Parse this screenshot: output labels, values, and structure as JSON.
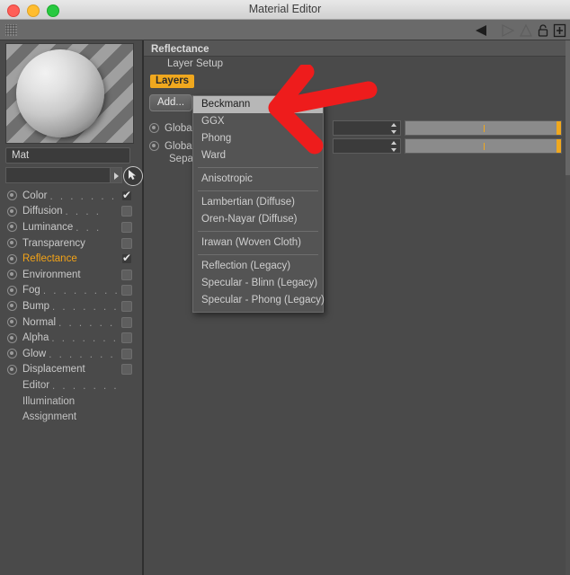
{
  "window": {
    "title": "Material Editor",
    "traffic_lights": [
      "close-red",
      "minimize-yellow",
      "zoom-green"
    ]
  },
  "toolbar": {
    "grip_icon": "dotted-grip-icon",
    "icons": [
      "back-triangle-icon",
      "forward-triangle-icon",
      "up-triangle-icon",
      "lock-icon",
      "plus-box-icon"
    ]
  },
  "left_panel": {
    "preview_alt": "material-preview-sphere",
    "name_value": "Mat",
    "filter_value": "",
    "filter_arrow_icon": "triangle-right-icon",
    "picker_icon": "cursor-picker-icon",
    "channels": [
      {
        "label": "Color",
        "dots": ". . . . . . .",
        "checked": true,
        "active": false
      },
      {
        "label": "Diffusion",
        "dots": ". . . .",
        "checked": false,
        "active": false
      },
      {
        "label": "Luminance",
        "dots": ". . .",
        "checked": false,
        "active": false
      },
      {
        "label": "Transparency",
        "dots": "",
        "checked": false,
        "active": false
      },
      {
        "label": "Reflectance",
        "dots": "",
        "checked": true,
        "active": true
      },
      {
        "label": "Environment",
        "dots": "",
        "checked": false,
        "active": false
      },
      {
        "label": "Fog",
        "dots": ". . . . . . . .",
        "checked": false,
        "active": false
      },
      {
        "label": "Bump",
        "dots": ". . . . . . .",
        "checked": false,
        "active": false
      },
      {
        "label": "Normal",
        "dots": ". . . . . .",
        "checked": false,
        "active": false
      },
      {
        "label": "Alpha",
        "dots": ". . . . . . .",
        "checked": false,
        "active": false
      },
      {
        "label": "Glow",
        "dots": ". . . . . . . .",
        "checked": false,
        "active": false
      },
      {
        "label": "Displacement",
        "dots": "",
        "checked": false,
        "active": false
      }
    ],
    "sub_items": [
      {
        "label": "Editor",
        "dots": ". . . . . . ."
      },
      {
        "label": "Illumination",
        "dots": ""
      },
      {
        "label": "Assignment",
        "dots": ""
      }
    ]
  },
  "right_panel": {
    "header": "Reflectance",
    "subheader": "Layer Setup",
    "layers_tab": "Layers",
    "add_button": "Add...",
    "rows": [
      {
        "label": "Global Reflection Brightness",
        "short": "Global"
      },
      {
        "label": "Global Specular Brightness",
        "short": "Global"
      }
    ],
    "separate_label": "Separate Passes"
  },
  "dropdown": {
    "items": [
      {
        "label": "Beckmann",
        "selected": true,
        "sep_after": false
      },
      {
        "label": "GGX",
        "selected": false,
        "sep_after": false
      },
      {
        "label": "Phong",
        "selected": false,
        "sep_after": false
      },
      {
        "label": "Ward",
        "selected": false,
        "sep_after": true
      },
      {
        "label": "Anisotropic",
        "selected": false,
        "sep_after": true
      },
      {
        "label": "Lambertian (Diffuse)",
        "selected": false,
        "sep_after": false
      },
      {
        "label": "Oren-Nayar (Diffuse)",
        "selected": false,
        "sep_after": true
      },
      {
        "label": "Irawan (Woven Cloth)",
        "selected": false,
        "sep_after": true
      },
      {
        "label": "Reflection (Legacy)",
        "selected": false,
        "sep_after": false
      },
      {
        "label": "Specular - Blinn (Legacy)",
        "selected": false,
        "sep_after": false
      },
      {
        "label": "Specular - Phong (Legacy)",
        "selected": false,
        "sep_after": false
      }
    ]
  },
  "annotation": {
    "arrow_color": "#ee1c1c",
    "arrow_name": "red-annotation-arrow",
    "points_to": "Beckmann"
  },
  "colors": {
    "accent_orange": "#f0a81e",
    "panel_bg": "#4a4a4a",
    "menu_bg": "#545454"
  }
}
